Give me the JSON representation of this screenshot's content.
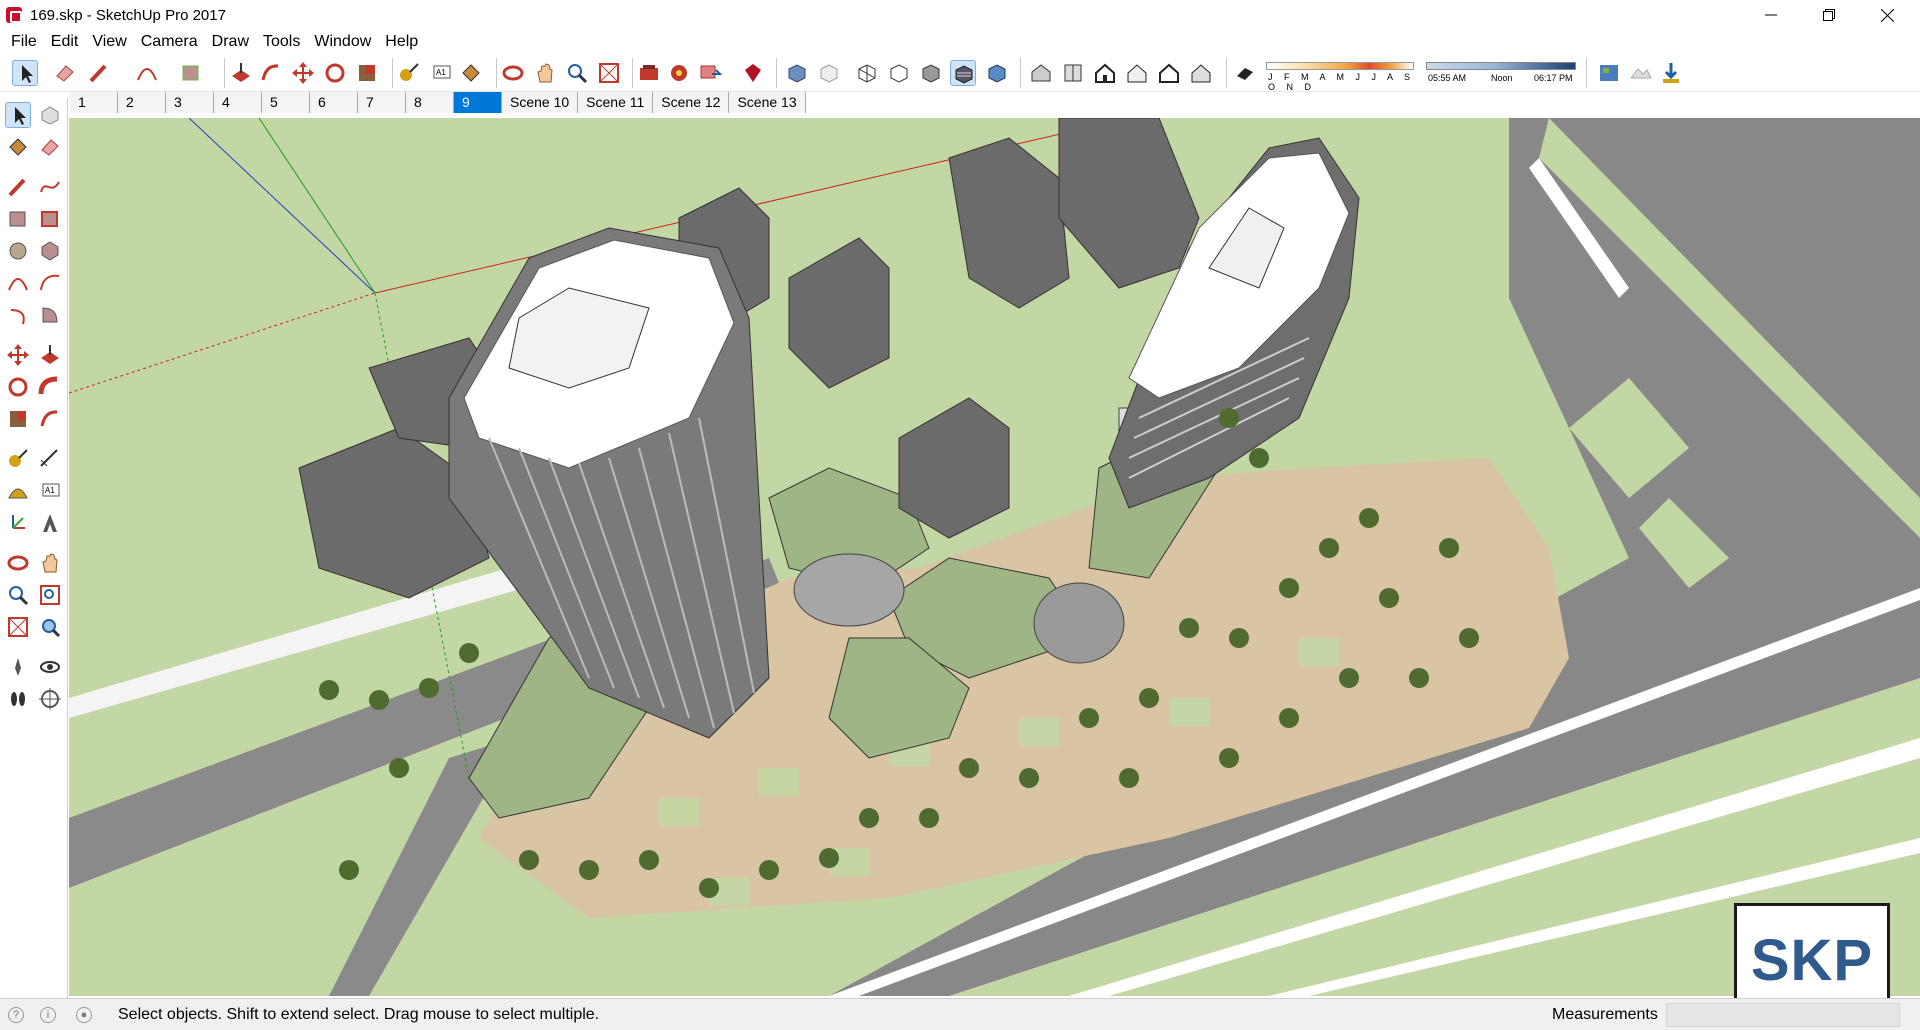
{
  "window": {
    "title": "169.skp - SketchUp Pro 2017",
    "controls": [
      "minimize",
      "restore",
      "close"
    ]
  },
  "menu": [
    "File",
    "Edit",
    "View",
    "Camera",
    "Draw",
    "Tools",
    "Window",
    "Help"
  ],
  "toolbar": {
    "shadow_months": "J F M A M J J A S O N D",
    "time_start": "05:55 AM",
    "time_mid": "Noon",
    "time_end": "06:17 PM"
  },
  "scenes": {
    "tabs": [
      "1",
      "2",
      "3",
      "4",
      "5",
      "6",
      "7",
      "8",
      "9",
      "Scene 10",
      "Scene 11",
      "Scene 12",
      "Scene 13"
    ],
    "active": "9"
  },
  "status": {
    "message": "Select objects. Shift to extend select. Drag mouse to select multiple.",
    "measurements_label": "Measurements",
    "measurements_value": ""
  },
  "logo": {
    "text": "SKP"
  },
  "colors": {
    "accent": "#0078d7",
    "grass": "#c3d7a5",
    "road": "#8a8a8a",
    "plaza": "#d9c4a4",
    "tower": "#777777",
    "roof": "#ffffff",
    "logo_blue": "#2f5a8c"
  }
}
